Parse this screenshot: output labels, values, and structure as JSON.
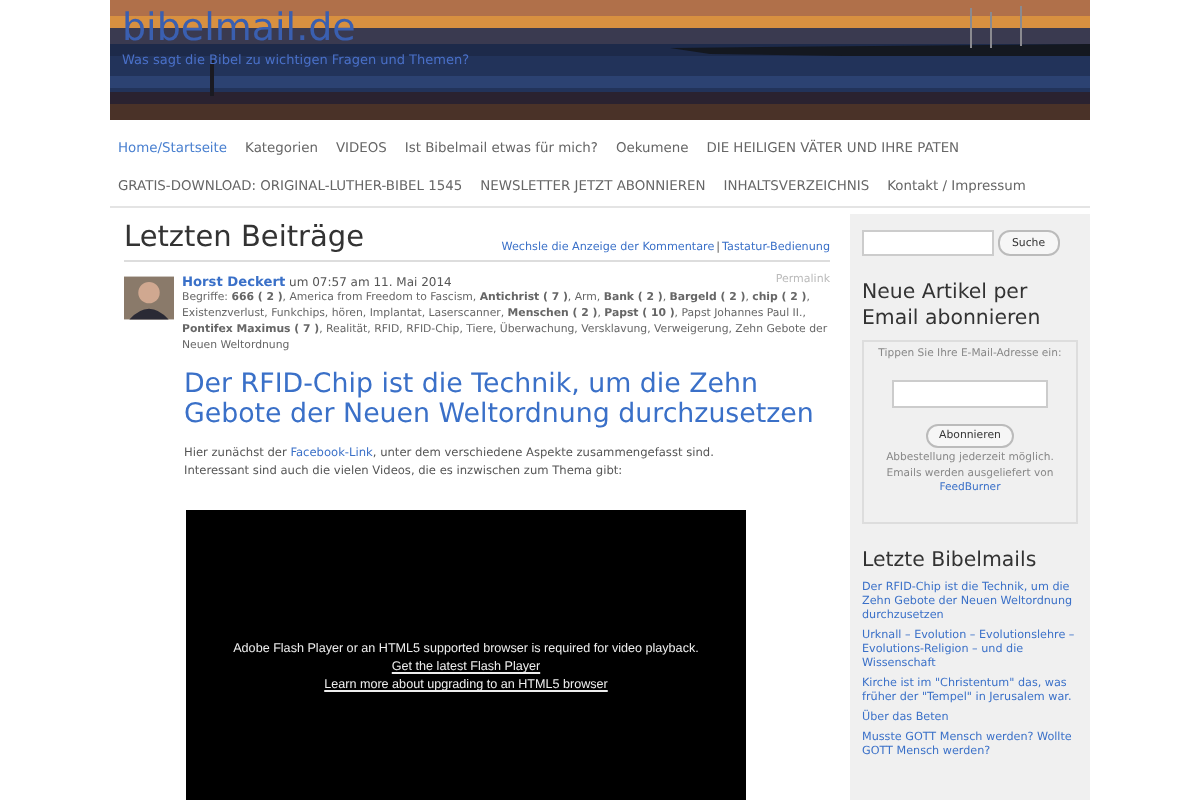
{
  "header": {
    "kind": "picture",
    "site_title": "bibelmail.de",
    "tagline": "Was sagt die Bibel zu wichtigen Fragen und Themen?"
  },
  "nav": [
    {
      "label": "Home/Startseite",
      "selected": true
    },
    {
      "label": "Kategorien",
      "selected": false
    },
    {
      "label": "VIDEOS",
      "selected": false
    },
    {
      "label": "Ist Bibelmail etwas für mich?",
      "selected": false
    },
    {
      "label": "Oekumene",
      "selected": false
    },
    {
      "label": "DIE HEILIGEN VÄTER UND IHRE PATEN",
      "selected": false
    },
    {
      "label": "GRATIS-DOWNLOAD: ORIGINAL-LUTHER-BIBEL 1545",
      "selected": false
    },
    {
      "label": "NEWSLETTER JETZT ABONNIEREN",
      "selected": false
    },
    {
      "label": "INHALTSVERZEICHNIS",
      "selected": false
    },
    {
      "label": "Kontakt / Impressum",
      "selected": false
    }
  ],
  "main": {
    "heading": "Letzten Beiträge",
    "links": [
      "Wechsle die Anzeige der Kommentare",
      "Tastatur-Bedienung"
    ],
    "links_separator": "|",
    "post": {
      "author": "Horst Deckert",
      "date": "um 07:57 am 11. Mai 2014",
      "permalink": "Permalink",
      "tags": "Begriffe: **666 ( 2 )**, America from Freedom to Fascism, **Antichrist ( 7 )**, Arm, **Bank ( 2 )**, **Bargeld ( 2 )**, **chip ( 2 )**, Existenzverlust, Funkchips, hören, Implantat, Laserscanner, **Menschen ( 2 )**, **Papst ( 10 )**, Papst Johannes Paul II., **Pontifex Maximus ( 7 )**, Realität, RFID, RFID-Chip, Tiere, Überwachung, Versklavung, Verweigerung, Zehn Gebote der Neuen Weltordnung",
      "title": "Der RFID-Chip ist die Technik, um die Zehn Gebote der Neuen Weltordnung durchzusetzen",
      "intro_before": "Hier zunächst der",
      "intro_link": "Facebook-Link",
      "intro_after": ", unter dem verschiedene Aspekte zusammengefasst sind.",
      "intro_second": "Interessant sind auch die vielen Videos, die es inzwischen zum Thema gibt:",
      "video": {
        "message": "Adobe Flash Player or an HTML5 supported browser is required for video playback.",
        "links": [
          "Get the latest Flash Player",
          "Learn more about upgrading to an HTML5 browser"
        ]
      }
    }
  },
  "sidebar": {
    "search_button": "Suche",
    "subscribe": {
      "heading": "Neue Artikel per Email abonnieren",
      "prompt": "Tippen Sie Ihre E-Mail-Adresse ein:",
      "button": "Abonnieren",
      "note": "Abbestellung jederzeit möglich. Emails werden ausgeliefert von",
      "link": "FeedBurner"
    },
    "recent": {
      "heading": "Letzte Bibelmails",
      "items": [
        "Der RFID-Chip ist die Technik, um die Zehn Gebote der Neuen Weltordnung durchzusetzen",
        "Urknall – Evolution – Evolutionslehre – Evolutions-Religion – und die Wissenschaft",
        "Kirche ist im \"Christentum\" das, was früher der \"Tempel\" in Jerusalem war.",
        "Über das Beten",
        "Musste GOTT Mensch werden? Wollte GOTT Mensch werden?"
      ]
    }
  }
}
